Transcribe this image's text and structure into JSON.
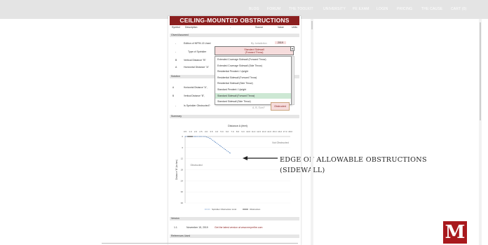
{
  "nav": {
    "items": [
      "BLOG",
      "FORUM",
      "THE TOOLKIT",
      "UNIVERSITY",
      "PE EXAM",
      "LOGIN",
      "PRICING",
      "THE CAUSE",
      "CART (0)"
    ]
  },
  "sheet": {
    "title": "CEILING-MOUNTED OBSTRUCTIONS",
    "columns": [
      "Symbol",
      "Description",
      "-",
      "Source",
      "Value",
      "Units"
    ],
    "given_section": "Given/Assumed",
    "given_rows": [
      {
        "symbol": "-",
        "description": "Edition of NFPA 13 Used",
        "source": "By Jurisdiction",
        "value": "2019"
      },
      {
        "symbol": "-",
        "description": "Type of Sprinkler",
        "value": ""
      },
      {
        "symbol": "B",
        "description": "Vertical Distance \"B\"",
        "value": ""
      },
      {
        "symbol": "A",
        "description": "Horizontal Distance \"A\"",
        "value": ""
      }
    ],
    "selected_sprinkler": {
      "line1": "Standard Sidewall",
      "line2": "(Forward Throw)"
    },
    "dropdown_options": [
      "Extended Coverage Sidewall (Forward Throw)",
      "Extended Coverage Sidewall (Side Throw)",
      "Residential Pendent / Upright",
      "Residential Sidewall (Forward Throw)",
      "Residential Sidewall (Side Throw)",
      "Standard Pendent / Upright",
      "Standard Sidewall (Forward Throw)",
      "Standard Sidewall (Side Throw)"
    ],
    "dropdown_selected_index": 6,
    "solution_section": "Solution",
    "solution_rows": [
      {
        "symbol": "A",
        "description": "Horizontal Distance \"A\","
      },
      {
        "symbol": "B",
        "description": "Vertical Distance \"B\","
      },
      {
        "symbol": "-",
        "description": "Is Sprinkler Obstructed?",
        "source": "A, B, Sum?"
      }
    ],
    "obstructed_value": "Obstructed",
    "summary_section": "Summary",
    "version_section": "Version",
    "version_row": {
      "number": "1.1",
      "date": "November 15, 2019",
      "note": "Get the latest version at www.meyerfire.com"
    },
    "references_section": "References Used"
  },
  "chart_data": {
    "type": "line",
    "title": "Distance A (feet)",
    "xlabel": "Distance A (feet)",
    "ylabel": "Distance 'B' (inches)",
    "x_ticks": [
      "0.5",
      "1.0",
      "2.0",
      "2.5",
      "3.0",
      "3.5",
      "4.0",
      "5.0",
      "6.0",
      "7.0",
      "8.0",
      "9.0",
      "10.0",
      "11.0",
      "12.0",
      "13.0",
      "14.0",
      "15.0",
      "16.0",
      "17.0",
      "18.0"
    ],
    "y_ticks": [
      "0",
      "6",
      "12",
      "18",
      "24",
      "30",
      "36"
    ],
    "xlim": [
      0,
      21
    ],
    "ylim": [
      0,
      36
    ],
    "series": [
      {
        "name": "Sprinkler Obstruction Limit",
        "style": "dashed",
        "color": "#4f7fbd",
        "x": [
          0,
          1,
          2,
          3,
          4,
          5,
          6,
          7,
          8,
          9
        ],
        "y": [
          0,
          0,
          0,
          0,
          0,
          1,
          3,
          5,
          7,
          9
        ]
      },
      {
        "name": "Obstruction",
        "style": "solid",
        "color": "#333333",
        "x": [
          0.5,
          1.5
        ],
        "y": [
          0,
          0
        ]
      }
    ],
    "annotations": [
      "Not Obstructed",
      "Obstructed"
    ]
  },
  "callout": {
    "line1": "EDGE OF ALLOWABLE OBSTRUCTIONS",
    "line2": "(SIDEWALL)"
  },
  "logo": {
    "letter": "M",
    "color": "#a8191d"
  }
}
